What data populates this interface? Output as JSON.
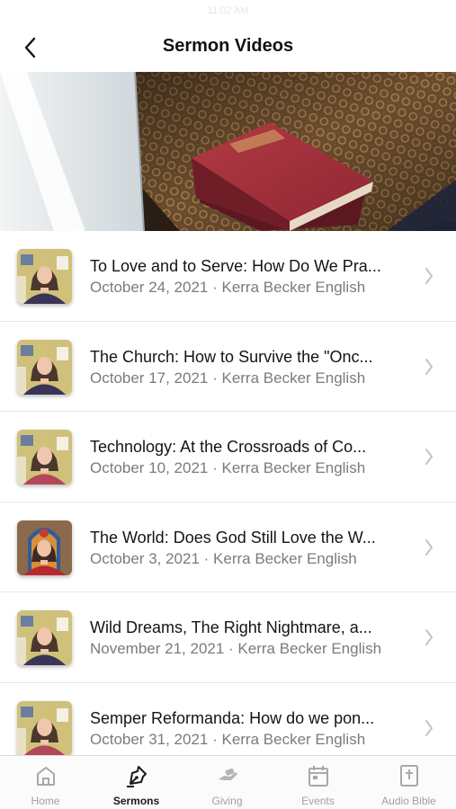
{
  "status_bar": {
    "time": "11:02 AM"
  },
  "header": {
    "title": "Sermon Videos"
  },
  "sermons": [
    {
      "title": "To Love and to Serve: How Do We Pra...",
      "meta": "October 24, 2021 · Kerra Becker English"
    },
    {
      "title": "The Church: How to Survive the \"Onc...",
      "meta": "October 17, 2021 · Kerra Becker English"
    },
    {
      "title": "Technology: At the Crossroads of Co...",
      "meta": "October 10, 2021 · Kerra Becker English"
    },
    {
      "title": "The World: Does God Still Love the W...",
      "meta": "October 3, 2021 · Kerra Becker English"
    },
    {
      "title": "Wild Dreams, The Right Nightmare, a...",
      "meta": "November 21, 2021 · Kerra Becker English"
    },
    {
      "title": "Semper Reformanda: How do we pon...",
      "meta": "October 31, 2021 · Kerra Becker English"
    }
  ],
  "tabs": [
    {
      "label": "Home",
      "icon": "home-icon",
      "active": false
    },
    {
      "label": "Sermons",
      "icon": "pen-nib-icon",
      "active": true
    },
    {
      "label": "Giving",
      "icon": "giving-icon",
      "active": false
    },
    {
      "label": "Events",
      "icon": "calendar-icon",
      "active": false
    },
    {
      "label": "Audio Bible",
      "icon": "bible-icon",
      "active": false
    }
  ],
  "colors": {
    "active_tab": "#1a1a1a",
    "inactive_tab": "#a0a0a0",
    "meta_text": "#7b7b7b",
    "bible_cover": "#a8333d"
  }
}
